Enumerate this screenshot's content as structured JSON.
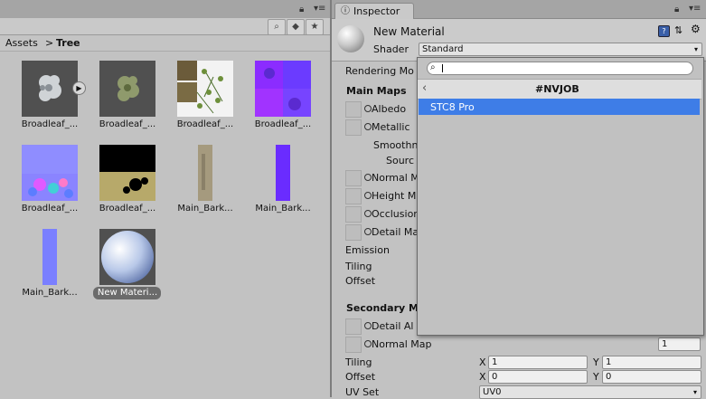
{
  "project": {
    "breadcrumb": {
      "root": "Assets",
      "separator": ">",
      "current": "Tree"
    },
    "assets": [
      {
        "label": "Broadleaf_..."
      },
      {
        "label": "Broadleaf_..."
      },
      {
        "label": "Broadleaf_..."
      },
      {
        "label": "Broadleaf_..."
      },
      {
        "label": "Broadleaf_..."
      },
      {
        "label": "Broadleaf_..."
      },
      {
        "label": "Main_Bark..."
      },
      {
        "label": "Main_Bark..."
      },
      {
        "label": "Main_Bark..."
      },
      {
        "label": "New Materi..."
      }
    ]
  },
  "inspector": {
    "tab_label": "Inspector",
    "material_name": "New Material",
    "shader_label": "Shader",
    "shader_value": "Standard",
    "rendering_mode": "Rendering Mo",
    "main_maps": "Main Maps",
    "albedo": "Albedo",
    "metallic": "Metallic",
    "smoothness": "Smoothn",
    "source": "Sourc",
    "normal_map_main": "Normal M",
    "height_map": "Height M",
    "occlusion": "Occlusion",
    "detail_mask": "Detail Ma",
    "emission": "Emission",
    "tiling": "Tiling",
    "offset": "Offset",
    "secondary_maps": "Secondary M",
    "detail_albedo": "Detail Al",
    "normal_map": "Normal Map",
    "normal_map_value": "1",
    "tiling2": "Tiling",
    "offset2": "Offset",
    "x_label": "X",
    "y_label": "Y",
    "tiling_x": "1",
    "tiling_y": "1",
    "offset_x": "0",
    "offset_y": "0",
    "uv_set_label": "UV Set",
    "uv_set_value": "UV0"
  },
  "dropdown": {
    "search_value": "",
    "header": "#NVJOB",
    "back_symbol": "‹",
    "items": [
      "STC8 Pro"
    ]
  },
  "colors": {
    "selection": "#3e7de7",
    "panel": "#c2c2c2"
  }
}
